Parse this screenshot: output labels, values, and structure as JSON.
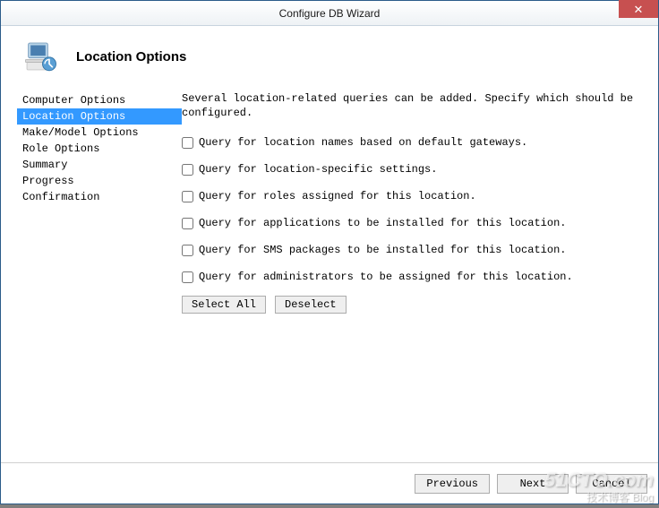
{
  "window": {
    "title": "Configure DB Wizard"
  },
  "header": {
    "title": "Location Options"
  },
  "sidebar": {
    "items": [
      {
        "label": "Computer Options",
        "selected": false
      },
      {
        "label": "Location Options",
        "selected": true
      },
      {
        "label": "Make/Model Options",
        "selected": false
      },
      {
        "label": "Role Options",
        "selected": false
      },
      {
        "label": "Summary",
        "selected": false
      },
      {
        "label": "Progress",
        "selected": false
      },
      {
        "label": "Confirmation",
        "selected": false
      }
    ]
  },
  "main": {
    "description": "Several location-related queries can be added.  Specify which should be configured.",
    "options": [
      {
        "label": "Query for location names based on default gateways.",
        "checked": false
      },
      {
        "label": "Query for location-specific settings.",
        "checked": false
      },
      {
        "label": "Query for roles assigned for this location.",
        "checked": false
      },
      {
        "label": "Query for applications to be installed for this location.",
        "checked": false
      },
      {
        "label": "Query for SMS packages to be installed for this location.",
        "checked": false
      },
      {
        "label": "Query for administrators to be assigned for this location.",
        "checked": false
      }
    ],
    "select_all_label": "Select All",
    "deselect_label": "Deselect"
  },
  "footer": {
    "previous_label": "Previous",
    "next_label": "Next",
    "cancel_label": "Cancel"
  },
  "watermark": {
    "main": "51CTO.com",
    "sub": "技术博客 Blog"
  }
}
